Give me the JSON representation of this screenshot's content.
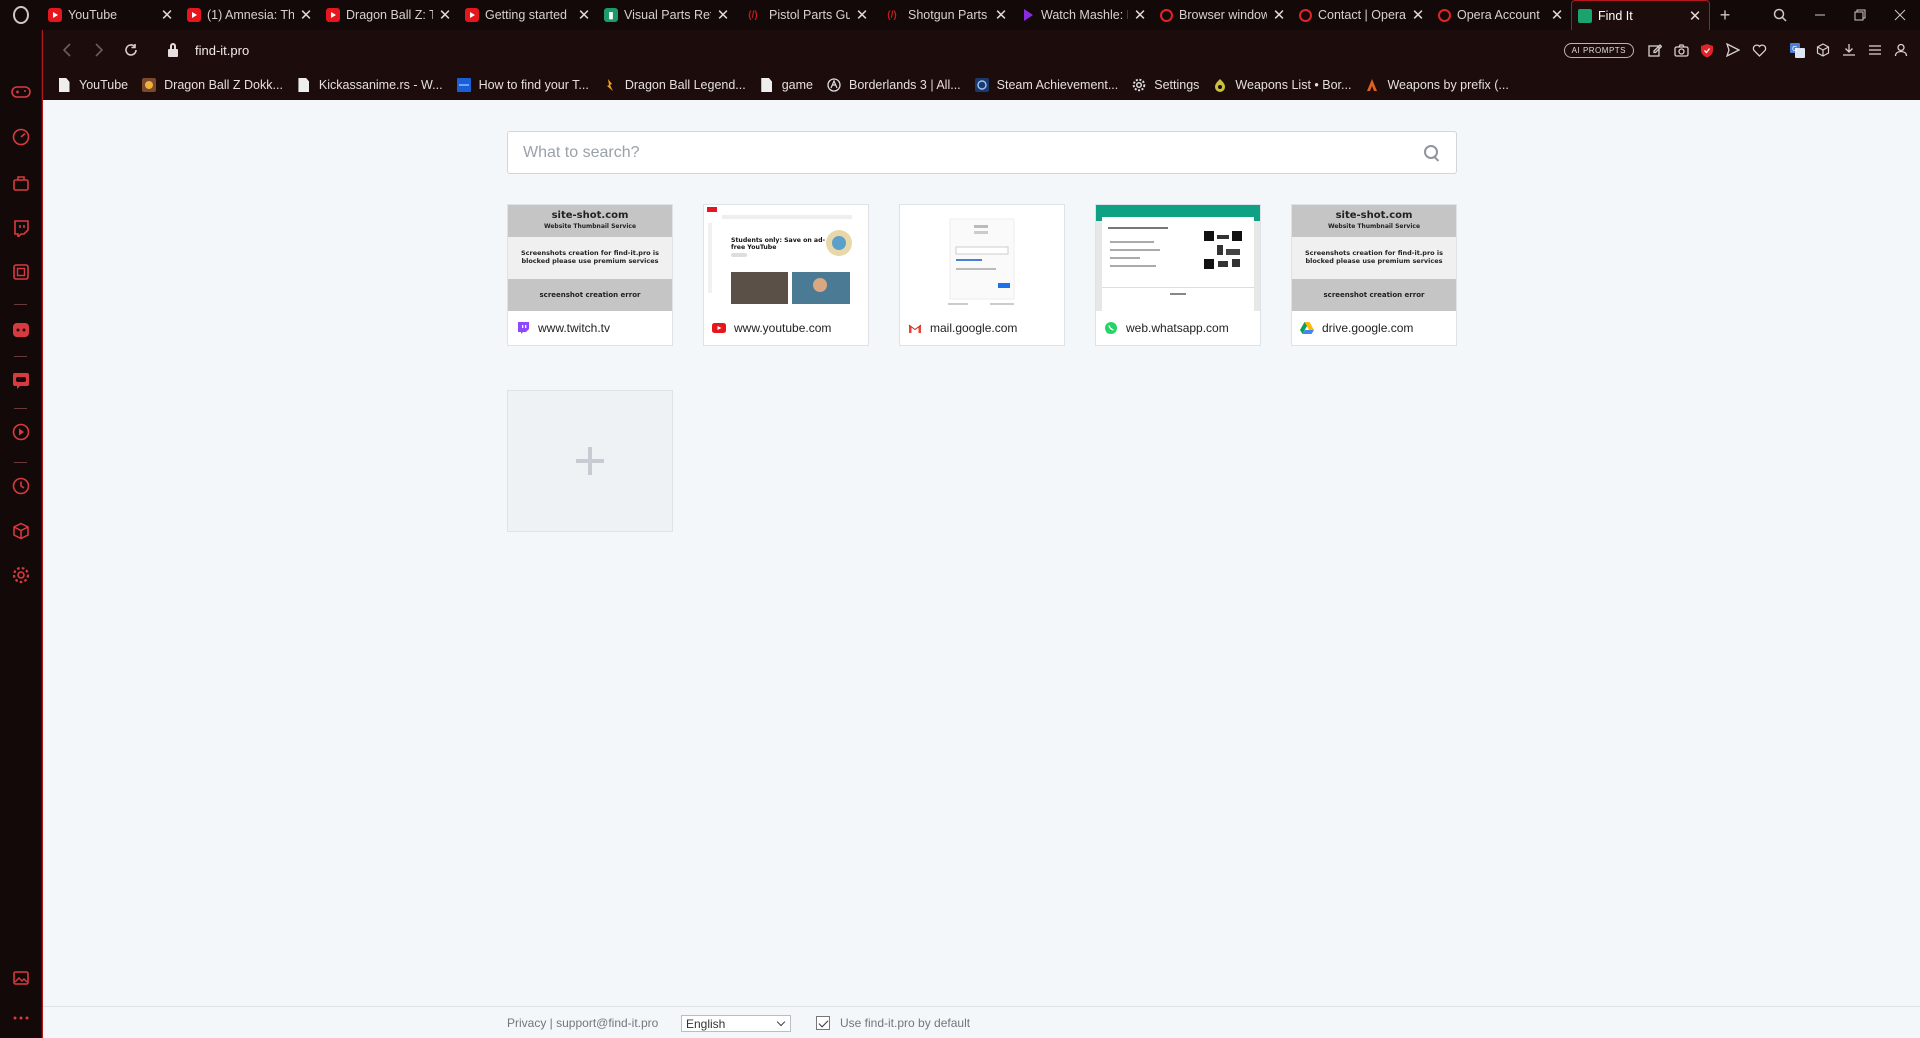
{
  "browser": {
    "tabs": [
      {
        "title": "YouTube",
        "icon": "youtube-icon",
        "active": false
      },
      {
        "title": "(1) Amnesia: Th",
        "icon": "youtube-icon",
        "active": false
      },
      {
        "title": "Dragon Ball Z: T",
        "icon": "youtube-icon",
        "active": false
      },
      {
        "title": "Getting started",
        "icon": "youtube-icon",
        "active": false
      },
      {
        "title": "Visual Parts Ref",
        "icon": "bookmark-green-icon",
        "active": false
      },
      {
        "title": "Pistol Parts Gui",
        "icon": "pp-logo-icon",
        "active": false
      },
      {
        "title": "Shotgun Parts G",
        "icon": "pp-logo-icon",
        "active": false
      },
      {
        "title": "Watch Mashle: I",
        "icon": "play-purple-icon",
        "active": false
      },
      {
        "title": "Browser window",
        "icon": "opera-icon",
        "active": false
      },
      {
        "title": "Contact | Opera",
        "icon": "opera-icon",
        "active": false
      },
      {
        "title": "Opera Account",
        "icon": "opera-icon",
        "active": false
      },
      {
        "title": "Find It",
        "icon": "folder-green-icon",
        "active": true
      }
    ],
    "url": "find-it.pro",
    "ai_prompts_label": "AI PROMPTS",
    "bookmarks": [
      {
        "label": "YouTube",
        "icon": "document-icon"
      },
      {
        "label": "Dragon Ball Z Dokk...",
        "icon": "game-icon"
      },
      {
        "label": "Kickassanime.rs - W...",
        "icon": "document-icon"
      },
      {
        "label": "How to find your T...",
        "icon": "blue-square-icon"
      },
      {
        "label": "Dragon Ball Legend...",
        "icon": "dragonball-icon"
      },
      {
        "label": "game",
        "icon": "document-icon"
      },
      {
        "label": "Borderlands 3 | All...",
        "icon": "borderlands-icon"
      },
      {
        "label": "Steam Achievement...",
        "icon": "steam-icon"
      },
      {
        "label": "Settings",
        "icon": "gear-icon"
      },
      {
        "label": "Weapons List • Bor...",
        "icon": "fandom-icon"
      },
      {
        "label": "Weapons by prefix (...",
        "icon": "flame-icon"
      }
    ]
  },
  "page": {
    "search_placeholder": "What to search?",
    "tiles": [
      {
        "domain": "www.twitch.tv",
        "icon": "twitch-icon",
        "thumb": "site-shot"
      },
      {
        "domain": "www.youtube.com",
        "icon": "youtube-icon",
        "thumb": "youtube"
      },
      {
        "domain": "mail.google.com",
        "icon": "gmail-icon",
        "thumb": "gmail"
      },
      {
        "domain": "web.whatsapp.com",
        "icon": "whatsapp-icon",
        "thumb": "whatsapp"
      },
      {
        "domain": "drive.google.com",
        "icon": "google-drive-icon",
        "thumb": "site-shot"
      }
    ],
    "siteshot": {
      "title": "site-shot.com",
      "subtitle": "Website Thumbnail Service",
      "blocked": "Screenshots creation for find-it.pro is blocked please use premium services",
      "error": "screenshot creation error"
    },
    "youtube_thumb": {
      "headline": "Students only: Save on ad-free YouTube"
    },
    "footer": {
      "links": "Privacy | support@find-it.pro",
      "language": "English",
      "default_label": "Use find-it.pro by default",
      "default_checked": true
    }
  },
  "colors": {
    "accent": "#b3171b",
    "chrome_bg": "#1c0c0c",
    "page_bg": "#f4f7fa"
  }
}
